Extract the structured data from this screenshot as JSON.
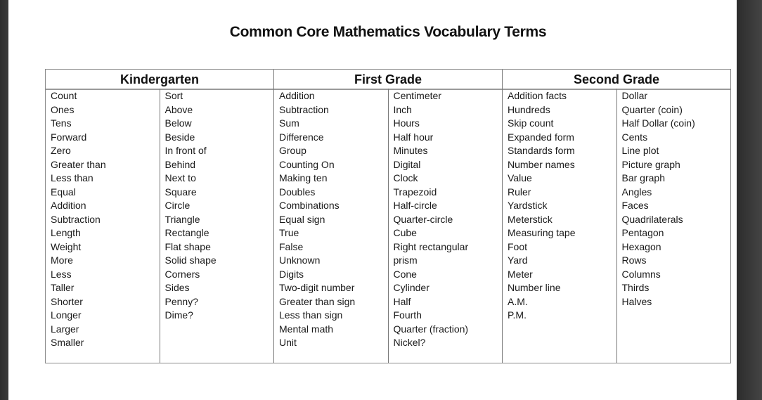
{
  "document": {
    "title": "Common Core Mathematics Vocabulary Terms"
  },
  "table": {
    "headers": [
      "Kindergarten",
      "First Grade",
      "Second Grade"
    ],
    "columns": [
      [
        "Count",
        "Ones",
        "Tens",
        "Forward",
        "Zero",
        "Greater than",
        "Less than",
        "Equal",
        "Addition",
        "Subtraction",
        "Length",
        "Weight",
        "More",
        "Less",
        "Taller",
        "Shorter",
        "Longer",
        "Larger",
        "Smaller"
      ],
      [
        "Sort",
        "Above",
        "Below",
        "Beside",
        "In front of",
        "Behind",
        "Next to",
        "Square",
        "Circle",
        "Triangle",
        "Rectangle",
        "Flat shape",
        "Solid shape",
        "Corners",
        "Sides",
        "Penny?",
        "Dime?"
      ],
      [
        "Addition",
        "Subtraction",
        "Sum",
        "Difference",
        "Group",
        "Counting On",
        "Making ten",
        "Doubles",
        "Combinations",
        "Equal sign",
        "True",
        "False",
        "Unknown",
        "Digits",
        "Two-digit number",
        "Greater than sign",
        "Less than sign",
        "Mental math",
        "Unit"
      ],
      [
        "Centimeter",
        "Inch",
        "Hours",
        "Half hour",
        "Minutes",
        "Digital",
        "Clock",
        "Trapezoid",
        "Half-circle",
        "Quarter-circle",
        "Cube",
        "Right rectangular",
        "prism",
        "Cone",
        "Cylinder",
        "Half",
        "Fourth",
        "Quarter (fraction)",
        "Nickel?"
      ],
      [
        "Addition facts",
        "Hundreds",
        "Skip count",
        "Expanded form",
        "Standards form",
        "Number names",
        "Value",
        "Ruler",
        "Yardstick",
        "Meterstick",
        "Measuring tape",
        "Foot",
        "Yard",
        "Meter",
        "Number line",
        "A.M.",
        "P.M."
      ],
      [
        "Dollar",
        "Quarter (coin)",
        "Half Dollar (coin)",
        "Cents",
        "Line plot",
        "Picture graph",
        "Bar graph",
        "Angles",
        "Faces",
        "Quadrilaterals",
        "Pentagon",
        "Hexagon",
        "Rows",
        "Columns",
        "Thirds",
        "Halves"
      ]
    ]
  }
}
